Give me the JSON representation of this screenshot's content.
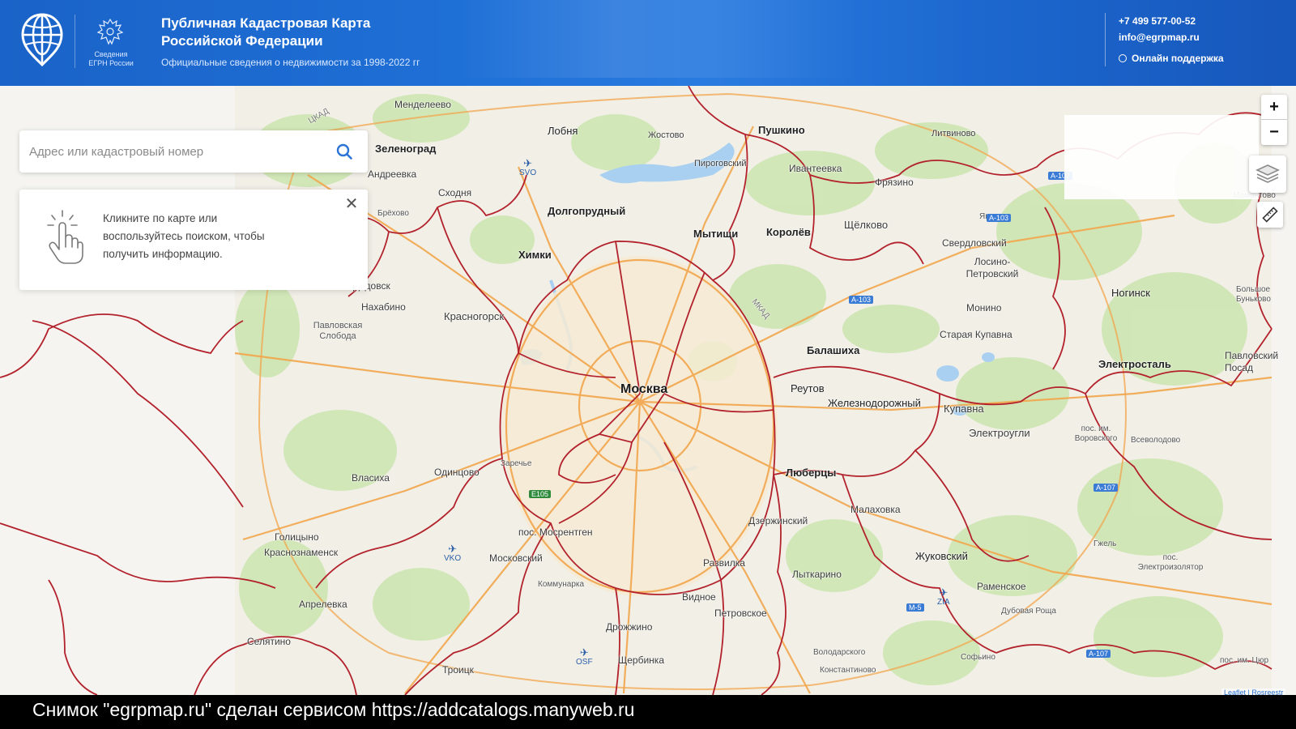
{
  "header": {
    "title": "Публичная Кадастровая Карта Российской Федерации",
    "subtitle": "Официальные сведения о недвижимости за 1998-2022 гг",
    "emblem_caption": "Сведения ЕГРН России",
    "phone": "+7 499 577-00-52",
    "email": "info@egrpmap.ru",
    "support_label": "Онлайн поддержка"
  },
  "search": {
    "placeholder": "Адрес или кадастровый номер",
    "value": ""
  },
  "info_panel": {
    "text": "Кликните по карте или воспользуйтесь поиском, чтобы получить информацию.",
    "close_icon": "close-icon"
  },
  "controls": {
    "zoom_in": "+",
    "zoom_out": "−",
    "layers_icon": "layers-icon",
    "ruler_icon": "ruler-icon"
  },
  "map": {
    "center_label": "Москва",
    "places": [
      "Менделеево",
      "Лобня",
      "Жостово",
      "Пушкино",
      "Литвиново",
      "Зеленоград",
      "Андреевка",
      "Пироговский",
      "Ивантеевка",
      "Фрязино",
      "Сходня",
      "Брёхово",
      "Долгопрудный",
      "Мытищи",
      "Королёв",
      "Щёлково",
      "Ямкино",
      "Свердловский",
      "Лосино-Петровский",
      "Химки",
      "Дедовск",
      "Нахабино",
      "Красногорск",
      "Монино",
      "Ногинск",
      "Большое Буньково",
      "Павловская Слобода",
      "Старая Купавна",
      "Балашиха",
      "Электросталь",
      "Павловский Посад",
      "Реутов",
      "Железнодорожный",
      "Купавна",
      "Электроугли",
      "пос. им. Воровского",
      "Всеволодово",
      "Власиха",
      "Одинцово",
      "Заречье",
      "Люберцы",
      "Малаховка",
      "Голицыно",
      "пос. Мосрентген",
      "Дзержинский",
      "Краснознаменск",
      "Московский",
      "Развилка",
      "Жуковский",
      "Гжель",
      "пос. Электроизолятор",
      "Коммунарка",
      "Лыткарино",
      "Раменское",
      "Апрелевка",
      "Видное",
      "Петровское",
      "Дубовая Роща",
      "Селятино",
      "Дрожжино",
      "Володарского",
      "Софьино",
      "Щербинка",
      "Троицк",
      "Константиново",
      "пос. им. Цюр",
      "Мамонтово"
    ],
    "roads": [
      "A-103",
      "A-103",
      "A-107",
      "A-107",
      "A-107",
      "M-5",
      "E105",
      "ЦКАД",
      "МКАД"
    ],
    "airports": [
      "SVO",
      "VKO",
      "ZIA",
      "OSF"
    ],
    "attribution": "Leaflet | Rosreestr"
  },
  "caption": {
    "text": "Снимок \"egrpmap.ru\" сделан сервисом https://addcatalogs.manyweb.ru"
  },
  "colors": {
    "header_blue": "#1e6fd6",
    "boundary_red": "#b3222c",
    "road_orange": "#f2a64c",
    "forest_green": "#cfe6b4",
    "water_blue": "#a9d0f0"
  }
}
